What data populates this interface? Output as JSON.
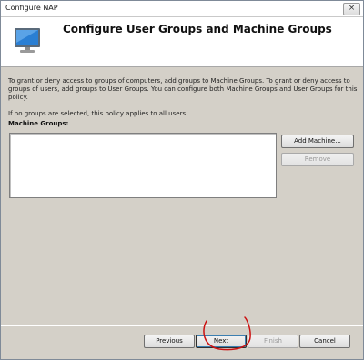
{
  "window": {
    "title": "Configure NAP",
    "close_label": "×"
  },
  "header": {
    "title": "Configure User Groups and Machine Groups",
    "icon": "computer-monitor-icon"
  },
  "body": {
    "description": "To grant or deny access to groups of computers, add groups to Machine Groups. To grant or deny access to groups of users, add groups to User Groups. You can configure both Machine Groups and User Groups for this policy.",
    "hint": "If no groups are selected, this policy applies to all users.",
    "list_label": "Machine Groups:",
    "list_items": []
  },
  "buttons": {
    "add_machine": "Add Machine...",
    "remove": "Remove",
    "previous": "Previous",
    "next": "Next",
    "finish": "Finish",
    "cancel": "Cancel"
  },
  "colors": {
    "dialog_bg": "#d4d0c8",
    "header_bg": "#ffffff",
    "annotation": "#cc1111"
  }
}
